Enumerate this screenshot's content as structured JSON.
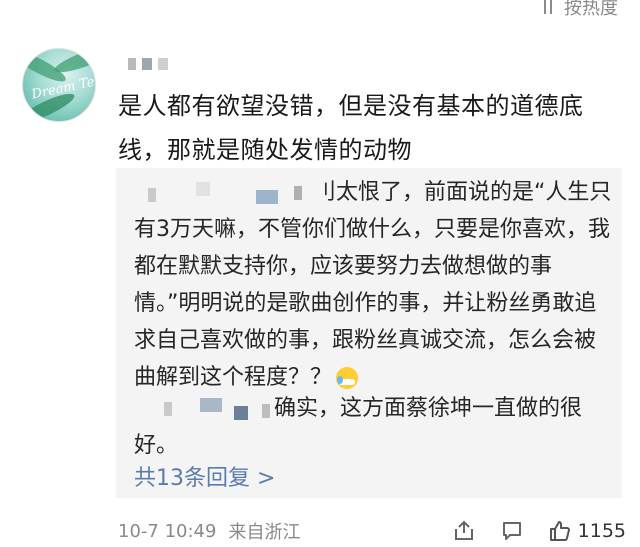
{
  "sort": {
    "label": "按热度"
  },
  "comment": {
    "avatar_text": "Dream Team",
    "text": "是人都有欲望没错，但是没有基本的道德底线，那就是随处发情的动物",
    "time": "10-7 10:49",
    "location": "来自浙江",
    "likes": "1155"
  },
  "replies": [
    {
      "text": "刂太恨了，前面说的是“人生只有3万天嘛，不管你们做什么，只要是你喜欢，我都在默默支持你，应该要努力去做想做的事情。”明明说的是歌曲创作的事，并让粉丝勇敢追求自己喜欢做的事，跟粉丝真诚交流，怎么会被曲解到这个程度？？"
    },
    {
      "text": "确实，这方面蔡徐坤一直做的很好。"
    }
  ],
  "reply_link": "共13条回复 >",
  "icons": {
    "sort": "sort-icon",
    "share": "share-icon",
    "comment": "comment-icon",
    "like": "thumbs-up-icon",
    "emoji": "laugh-cry-mask-emoji"
  },
  "colors": {
    "link": "#5b7bb0",
    "reply_bg": "#f4f4f4",
    "meta": "#8a8a8a"
  }
}
